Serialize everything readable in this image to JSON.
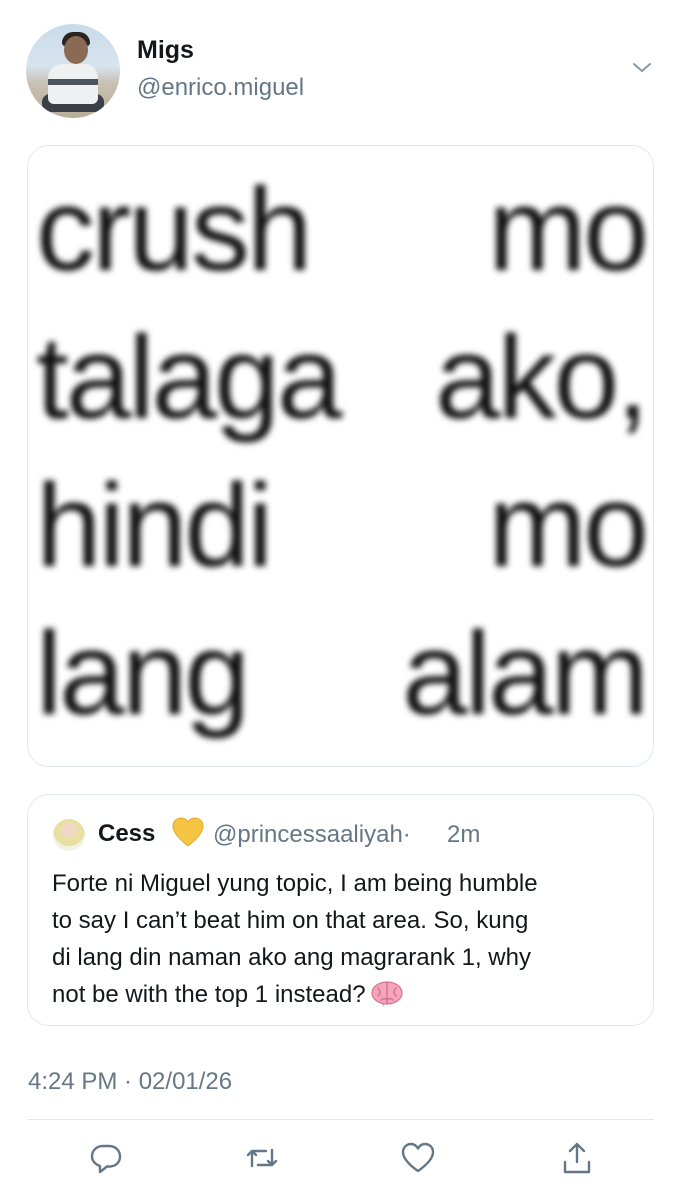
{
  "author": {
    "display_name": "Migs",
    "handle": "@enrico.miguel"
  },
  "meme_image": {
    "lines": [
      [
        "crush",
        "mo"
      ],
      [
        "talaga",
        "ako,"
      ],
      [
        "hindi",
        "mo"
      ],
      [
        "lang",
        "alam"
      ]
    ]
  },
  "quoted_tweet": {
    "name": "Cess",
    "name_emoji": "yellow-heart-icon",
    "handle": "@princessaaliyah",
    "separator": "·",
    "time": "2m",
    "body_lines": [
      "Forte ni Miguel yung topic, I am being humble",
      "to say I can’t beat him on that area. So, kung",
      "di lang din naman ako ang magrarank 1, why",
      "not be with the top 1 instead?"
    ],
    "trailing_emoji": "brain-icon"
  },
  "timestamp": "4:24 PM · 02/01/26",
  "actions": [
    "reply-icon",
    "retweet-icon",
    "like-icon",
    "share-icon"
  ],
  "colors": {
    "text": "#14171a",
    "muted": "#657786",
    "icon": "#657786",
    "border": "#e1e8ed"
  }
}
